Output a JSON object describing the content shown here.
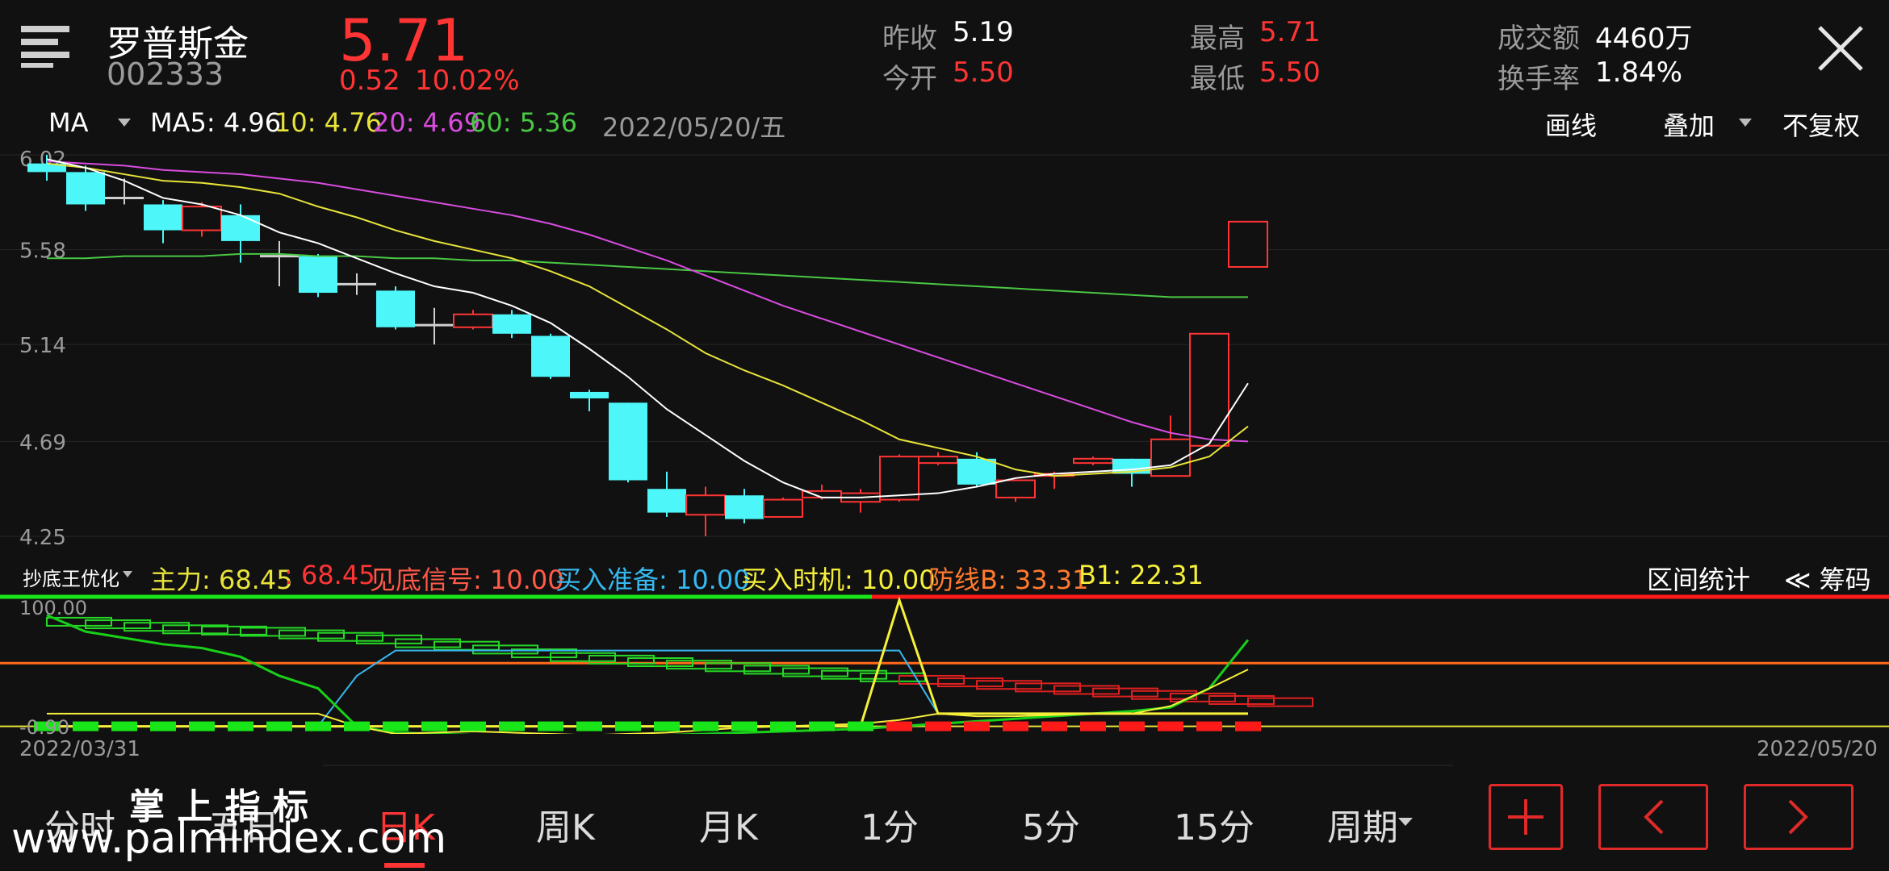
{
  "header": {
    "name": "罗普斯金",
    "code": "002333",
    "price": "5.71",
    "change": "0.52",
    "change_pct": "10.02%",
    "stats": [
      {
        "label": "昨收",
        "value": "5.19"
      },
      {
        "label": "今开",
        "value": "5.50"
      },
      {
        "label": "最高",
        "value": "5.71"
      },
      {
        "label": "最低",
        "value": "5.50"
      },
      {
        "label": "成交额",
        "value": "4460万"
      },
      {
        "label": "换手率",
        "value": "1.84%"
      }
    ]
  },
  "ma_bar": {
    "selector": "MA",
    "ma5": "MA5: 4.96",
    "ma10": "10: 4.76",
    "ma20": "20: 4.69",
    "ma60": "60: 5.36",
    "date": "2022/05/20/五",
    "draw": "画线",
    "overlay": "叠加",
    "adjust": "不复权"
  },
  "indicator_bar": {
    "name": "抄底王优化",
    "zhuli": "主力: 68.45",
    "zhuli2": ": 68.45",
    "jiandi": "见底信号: 10.00",
    "zhunbei": "买入准备: 10.00",
    "shiji": "买入时机: 10.00",
    "fangxian": "防线B: 33.31",
    "b1": "B1: 22.31",
    "stats": "区间统计",
    "chips": "≪ 筹码"
  },
  "indicator_axis": {
    "top": "100.00",
    "bottom": "-0.90"
  },
  "date_axis": {
    "start": "2022/03/31",
    "end": "2022/05/20"
  },
  "tabs": [
    "分时",
    "五日",
    "日K",
    "周K",
    "月K",
    "1分",
    "5分",
    "15分",
    "周期"
  ],
  "active_tab": "日K",
  "watermark": {
    "line1": "掌 上 指 标",
    "line2": "www.palmindex.com"
  },
  "colors": {
    "up": "#ff3434",
    "down": "#4df6f8",
    "ma5": "#ffffff",
    "ma10": "#e8e33a",
    "ma20": "#d84ce0",
    "ma60": "#49c844"
  },
  "chart_data": {
    "type": "candlestick",
    "yticks": [
      "6.02",
      "5.58",
      "5.14",
      "4.69",
      "4.25"
    ],
    "ylim": [
      4.25,
      6.02
    ],
    "candles": [
      {
        "o": 5.98,
        "c": 5.94,
        "h": 6.02,
        "l": 5.9
      },
      {
        "o": 5.94,
        "c": 5.79,
        "h": 5.97,
        "l": 5.76
      },
      {
        "o": 5.82,
        "c": 5.82,
        "h": 5.91,
        "l": 5.79
      },
      {
        "o": 5.79,
        "c": 5.67,
        "h": 5.81,
        "l": 5.61
      },
      {
        "o": 5.67,
        "c": 5.78,
        "h": 5.8,
        "l": 5.64
      },
      {
        "o": 5.74,
        "c": 5.62,
        "h": 5.79,
        "l": 5.52
      },
      {
        "o": 5.55,
        "c": 5.55,
        "h": 5.62,
        "l": 5.41
      },
      {
        "o": 5.55,
        "c": 5.38,
        "h": 5.56,
        "l": 5.36
      },
      {
        "o": 5.42,
        "c": 5.42,
        "h": 5.47,
        "l": 5.37
      },
      {
        "o": 5.39,
        "c": 5.22,
        "h": 5.41,
        "l": 5.21
      },
      {
        "o": 5.23,
        "c": 5.23,
        "h": 5.31,
        "l": 5.14
      },
      {
        "o": 5.22,
        "c": 5.28,
        "h": 5.3,
        "l": 5.21
      },
      {
        "o": 5.28,
        "c": 5.19,
        "h": 5.3,
        "l": 5.17
      },
      {
        "o": 5.18,
        "c": 4.99,
        "h": 5.19,
        "l": 4.98
      },
      {
        "o": 4.92,
        "c": 4.89,
        "h": 4.93,
        "l": 4.83
      },
      {
        "o": 4.87,
        "c": 4.51,
        "h": 4.87,
        "l": 4.5
      },
      {
        "o": 4.47,
        "c": 4.36,
        "h": 4.55,
        "l": 4.34
      },
      {
        "o": 4.35,
        "c": 4.44,
        "h": 4.48,
        "l": 4.25
      },
      {
        "o": 4.44,
        "c": 4.33,
        "h": 4.47,
        "l": 4.31
      },
      {
        "o": 4.34,
        "c": 4.42,
        "h": 4.43,
        "l": 4.34
      },
      {
        "o": 4.43,
        "c": 4.46,
        "h": 4.49,
        "l": 4.42
      },
      {
        "o": 4.41,
        "c": 4.45,
        "h": 4.47,
        "l": 4.36
      },
      {
        "o": 4.42,
        "c": 4.62,
        "h": 4.63,
        "l": 4.41
      },
      {
        "o": 4.59,
        "c": 4.62,
        "h": 4.64,
        "l": 4.58
      },
      {
        "o": 4.61,
        "c": 4.49,
        "h": 4.64,
        "l": 4.48
      },
      {
        "o": 4.43,
        "c": 4.51,
        "h": 4.51,
        "l": 4.41
      },
      {
        "o": 4.53,
        "c": 4.54,
        "h": 4.55,
        "l": 4.47
      },
      {
        "o": 4.59,
        "c": 4.61,
        "h": 4.62,
        "l": 4.58
      },
      {
        "o": 4.61,
        "c": 4.54,
        "h": 4.61,
        "l": 4.48
      },
      {
        "o": 4.53,
        "c": 4.7,
        "h": 4.81,
        "l": 4.53
      },
      {
        "o": 4.67,
        "c": 5.19,
        "h": 5.19,
        "l": 4.67
      },
      {
        "o": 5.5,
        "c": 5.71,
        "h": 5.71,
        "l": 5.5
      }
    ],
    "ma5": [
      6.0,
      5.96,
      5.9,
      5.82,
      5.79,
      5.74,
      5.66,
      5.61,
      5.54,
      5.47,
      5.41,
      5.38,
      5.32,
      5.24,
      5.12,
      4.99,
      4.84,
      4.72,
      4.6,
      4.5,
      4.43,
      4.43,
      4.44,
      4.45,
      4.48,
      4.52,
      4.54,
      4.55,
      4.56,
      4.58,
      4.68,
      4.96
    ],
    "ma10": [
      5.98,
      5.96,
      5.93,
      5.9,
      5.89,
      5.87,
      5.84,
      5.78,
      5.73,
      5.67,
      5.62,
      5.58,
      5.54,
      5.48,
      5.41,
      5.31,
      5.21,
      5.1,
      5.02,
      4.95,
      4.87,
      4.79,
      4.7,
      4.66,
      4.62,
      4.56,
      4.53,
      4.54,
      4.55,
      4.57,
      4.62,
      4.76
    ],
    "ma20": [
      5.99,
      5.98,
      5.97,
      5.95,
      5.94,
      5.93,
      5.91,
      5.89,
      5.86,
      5.83,
      5.8,
      5.77,
      5.74,
      5.7,
      5.65,
      5.59,
      5.53,
      5.46,
      5.39,
      5.32,
      5.26,
      5.2,
      5.14,
      5.08,
      5.02,
      4.96,
      4.9,
      4.84,
      4.78,
      4.73,
      4.7,
      4.69
    ],
    "ma60": [
      5.54,
      5.54,
      5.55,
      5.55,
      5.55,
      5.56,
      5.56,
      5.55,
      5.55,
      5.54,
      5.54,
      5.53,
      5.53,
      5.52,
      5.51,
      5.5,
      5.49,
      5.48,
      5.47,
      5.46,
      5.45,
      5.44,
      5.43,
      5.42,
      5.41,
      5.4,
      5.39,
      5.38,
      5.37,
      5.36,
      5.36,
      5.36
    ],
    "indicator": {
      "ylim": [
        -0.9,
        100
      ],
      "zhuli_b1": [
        86,
        84,
        82,
        80,
        79,
        78,
        76,
        74,
        72,
        69,
        67,
        64,
        61,
        58,
        56,
        54,
        52,
        50,
        48,
        46,
        44,
        42,
        40,
        38,
        36,
        34,
        32,
        30,
        28,
        26,
        24,
        22.31
      ],
      "jiandi": [
        0,
        0,
        0,
        0,
        0,
        0,
        0,
        0,
        0,
        0,
        0,
        0,
        0,
        0,
        0,
        0,
        0,
        0,
        0,
        0,
        0,
        0,
        100,
        10,
        10,
        10,
        10,
        10,
        10,
        10,
        10,
        10
      ],
      "line_green": [
        88,
        75,
        70,
        65,
        62,
        55,
        40,
        30,
        0,
        -5,
        -6,
        -7,
        -8,
        -9,
        -9,
        -8,
        -7,
        -6,
        -5,
        -4,
        -3,
        -2,
        0,
        2,
        4,
        6,
        8,
        10,
        12,
        15,
        30,
        68.45
      ],
      "buy_prep": [
        0,
        0,
        0,
        0,
        0,
        0,
        0,
        0,
        40,
        60,
        60,
        60,
        60,
        60,
        60,
        60,
        60,
        60,
        60,
        60,
        60,
        60,
        60,
        10,
        10,
        10,
        10,
        10,
        10,
        10,
        10,
        10
      ],
      "buy_time": [
        10,
        10,
        10,
        10,
        10,
        10,
        10,
        10,
        0,
        -6,
        -5,
        -4,
        -5,
        -6,
        -7,
        -6,
        -5,
        -3,
        -1,
        0,
        1,
        2,
        5,
        10,
        8,
        8,
        9,
        10,
        10,
        16,
        30,
        45
      ],
      "levels": [
        50
      ]
    }
  }
}
